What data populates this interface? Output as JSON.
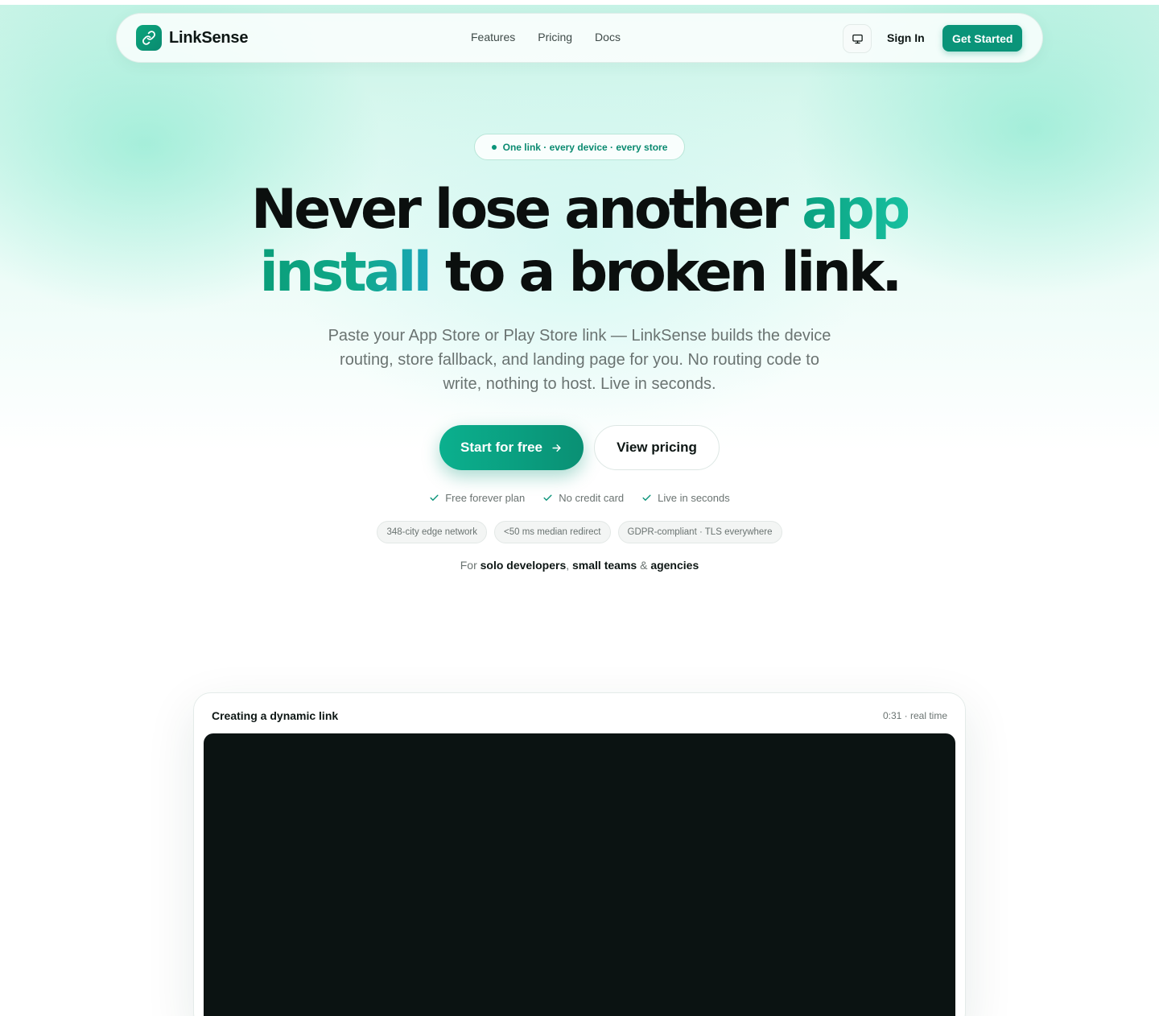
{
  "nav": {
    "brand": "LinkSense",
    "links": [
      "Features",
      "Pricing",
      "Docs"
    ],
    "theme_toggle_icon": "monitor-icon",
    "signin_label": "Sign In",
    "get_started_label": "Get Started"
  },
  "hero": {
    "pill_text": "One link · every device · every store",
    "headline": {
      "line1_a": "Never lose another ",
      "line1_b": "app",
      "line2_a": "install",
      "line2_b": " to a broken link."
    },
    "subtitle": "Paste your App Store or Play Store link — LinkSense builds the device routing, store fallback, and landing page for you. No routing code to write, nothing to host. Live in seconds.",
    "cta_primary": "Start for free",
    "cta_primary_icon": "arrow-right-icon",
    "cta_secondary": "View pricing",
    "checks": [
      "Free forever plan",
      "No credit card",
      "Live in seconds"
    ],
    "chips": [
      "348-city edge network",
      "<50 ms median redirect",
      "GDPR-compliant · TLS everywhere"
    ],
    "audience": {
      "prefix": "For ",
      "a": "solo developers",
      "sep1": ", ",
      "b": "small teams",
      "sep2": " & ",
      "c": "agencies"
    }
  },
  "demo": {
    "title": "Creating a dynamic link",
    "time": "0:31 · real time"
  },
  "colors": {
    "accent": "#0a9479",
    "accent_light": "#18c0a0",
    "text": "#0b0f0e",
    "muted": "#6a7371",
    "video_bg": "#0b1312"
  }
}
